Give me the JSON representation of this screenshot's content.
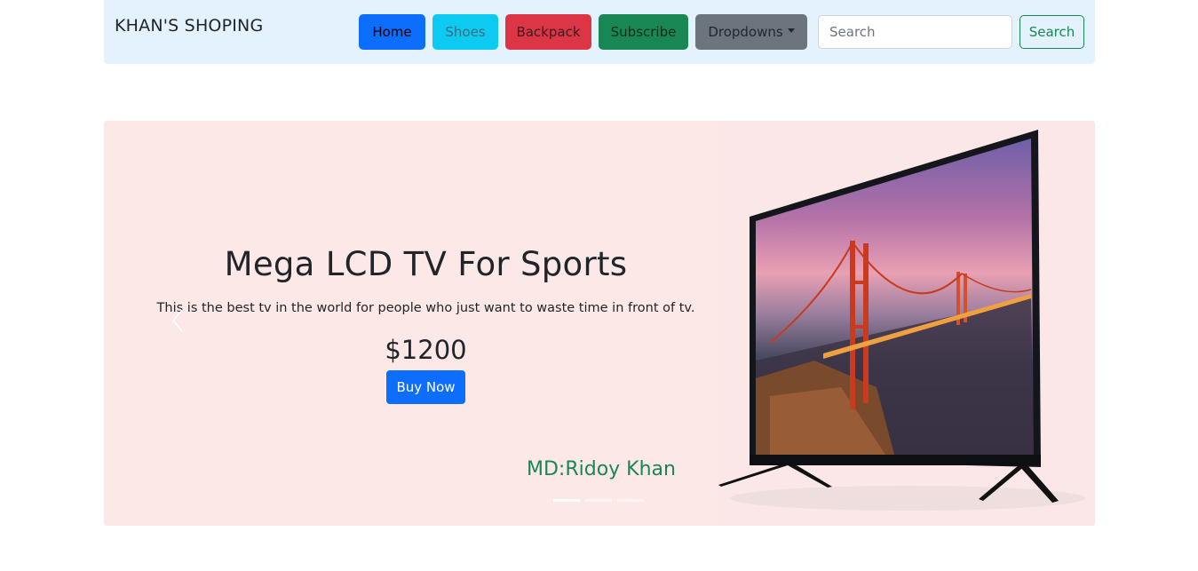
{
  "navbar": {
    "brand": "KHAN'S SHOPING",
    "buttons": {
      "home": "Home",
      "shoes": "Shoes",
      "backpack": "Backpack",
      "subscribe": "Subscribe",
      "dropdowns": "Dropdowns"
    },
    "search": {
      "placeholder": "Search",
      "button_label": "Search"
    }
  },
  "carousel": {
    "slide": {
      "title": "Mega LCD TV For Sports",
      "description": "This is the best tv in the world for people who just want to waste time in front of tv.",
      "price": "$1200",
      "cta": "Buy Now",
      "author": "MD:Ridoy Khan"
    },
    "indicator_count": 3,
    "active_indicator": 0
  },
  "colors": {
    "navbar_bg": "#e3f2fd",
    "carousel_bg": "#fde8e8",
    "primary": "#0d6efd",
    "info": "#0dcaf0",
    "danger": "#dc3545",
    "success": "#198754",
    "secondary": "#6c757d"
  },
  "icons": {
    "prev": "chevron-left-icon",
    "next": "chevron-right-icon",
    "dropdown": "caret-down-icon"
  }
}
